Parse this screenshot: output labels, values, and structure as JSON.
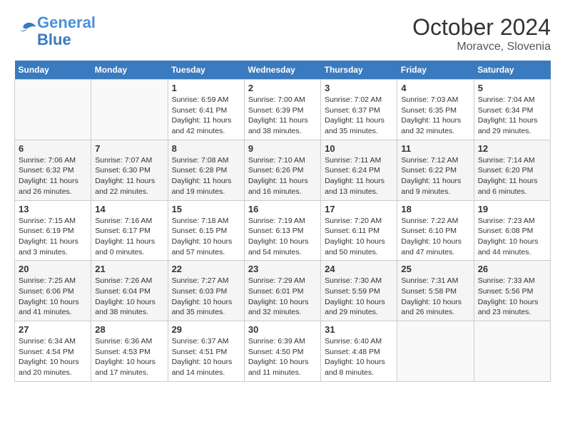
{
  "header": {
    "logo_line1": "General",
    "logo_line2": "Blue",
    "month": "October 2024",
    "location": "Moravce, Slovenia"
  },
  "weekdays": [
    "Sunday",
    "Monday",
    "Tuesday",
    "Wednesday",
    "Thursday",
    "Friday",
    "Saturday"
  ],
  "weeks": [
    [
      {
        "day": "",
        "info": ""
      },
      {
        "day": "",
        "info": ""
      },
      {
        "day": "1",
        "info": "Sunrise: 6:59 AM\nSunset: 6:41 PM\nDaylight: 11 hours and 42 minutes."
      },
      {
        "day": "2",
        "info": "Sunrise: 7:00 AM\nSunset: 6:39 PM\nDaylight: 11 hours and 38 minutes."
      },
      {
        "day": "3",
        "info": "Sunrise: 7:02 AM\nSunset: 6:37 PM\nDaylight: 11 hours and 35 minutes."
      },
      {
        "day": "4",
        "info": "Sunrise: 7:03 AM\nSunset: 6:35 PM\nDaylight: 11 hours and 32 minutes."
      },
      {
        "day": "5",
        "info": "Sunrise: 7:04 AM\nSunset: 6:34 PM\nDaylight: 11 hours and 29 minutes."
      }
    ],
    [
      {
        "day": "6",
        "info": "Sunrise: 7:06 AM\nSunset: 6:32 PM\nDaylight: 11 hours and 26 minutes."
      },
      {
        "day": "7",
        "info": "Sunrise: 7:07 AM\nSunset: 6:30 PM\nDaylight: 11 hours and 22 minutes."
      },
      {
        "day": "8",
        "info": "Sunrise: 7:08 AM\nSunset: 6:28 PM\nDaylight: 11 hours and 19 minutes."
      },
      {
        "day": "9",
        "info": "Sunrise: 7:10 AM\nSunset: 6:26 PM\nDaylight: 11 hours and 16 minutes."
      },
      {
        "day": "10",
        "info": "Sunrise: 7:11 AM\nSunset: 6:24 PM\nDaylight: 11 hours and 13 minutes."
      },
      {
        "day": "11",
        "info": "Sunrise: 7:12 AM\nSunset: 6:22 PM\nDaylight: 11 hours and 9 minutes."
      },
      {
        "day": "12",
        "info": "Sunrise: 7:14 AM\nSunset: 6:20 PM\nDaylight: 11 hours and 6 minutes."
      }
    ],
    [
      {
        "day": "13",
        "info": "Sunrise: 7:15 AM\nSunset: 6:19 PM\nDaylight: 11 hours and 3 minutes."
      },
      {
        "day": "14",
        "info": "Sunrise: 7:16 AM\nSunset: 6:17 PM\nDaylight: 11 hours and 0 minutes."
      },
      {
        "day": "15",
        "info": "Sunrise: 7:18 AM\nSunset: 6:15 PM\nDaylight: 10 hours and 57 minutes."
      },
      {
        "day": "16",
        "info": "Sunrise: 7:19 AM\nSunset: 6:13 PM\nDaylight: 10 hours and 54 minutes."
      },
      {
        "day": "17",
        "info": "Sunrise: 7:20 AM\nSunset: 6:11 PM\nDaylight: 10 hours and 50 minutes."
      },
      {
        "day": "18",
        "info": "Sunrise: 7:22 AM\nSunset: 6:10 PM\nDaylight: 10 hours and 47 minutes."
      },
      {
        "day": "19",
        "info": "Sunrise: 7:23 AM\nSunset: 6:08 PM\nDaylight: 10 hours and 44 minutes."
      }
    ],
    [
      {
        "day": "20",
        "info": "Sunrise: 7:25 AM\nSunset: 6:06 PM\nDaylight: 10 hours and 41 minutes."
      },
      {
        "day": "21",
        "info": "Sunrise: 7:26 AM\nSunset: 6:04 PM\nDaylight: 10 hours and 38 minutes."
      },
      {
        "day": "22",
        "info": "Sunrise: 7:27 AM\nSunset: 6:03 PM\nDaylight: 10 hours and 35 minutes."
      },
      {
        "day": "23",
        "info": "Sunrise: 7:29 AM\nSunset: 6:01 PM\nDaylight: 10 hours and 32 minutes."
      },
      {
        "day": "24",
        "info": "Sunrise: 7:30 AM\nSunset: 5:59 PM\nDaylight: 10 hours and 29 minutes."
      },
      {
        "day": "25",
        "info": "Sunrise: 7:31 AM\nSunset: 5:58 PM\nDaylight: 10 hours and 26 minutes."
      },
      {
        "day": "26",
        "info": "Sunrise: 7:33 AM\nSunset: 5:56 PM\nDaylight: 10 hours and 23 minutes."
      }
    ],
    [
      {
        "day": "27",
        "info": "Sunrise: 6:34 AM\nSunset: 4:54 PM\nDaylight: 10 hours and 20 minutes."
      },
      {
        "day": "28",
        "info": "Sunrise: 6:36 AM\nSunset: 4:53 PM\nDaylight: 10 hours and 17 minutes."
      },
      {
        "day": "29",
        "info": "Sunrise: 6:37 AM\nSunset: 4:51 PM\nDaylight: 10 hours and 14 minutes."
      },
      {
        "day": "30",
        "info": "Sunrise: 6:39 AM\nSunset: 4:50 PM\nDaylight: 10 hours and 11 minutes."
      },
      {
        "day": "31",
        "info": "Sunrise: 6:40 AM\nSunset: 4:48 PM\nDaylight: 10 hours and 8 minutes."
      },
      {
        "day": "",
        "info": ""
      },
      {
        "day": "",
        "info": ""
      }
    ]
  ]
}
